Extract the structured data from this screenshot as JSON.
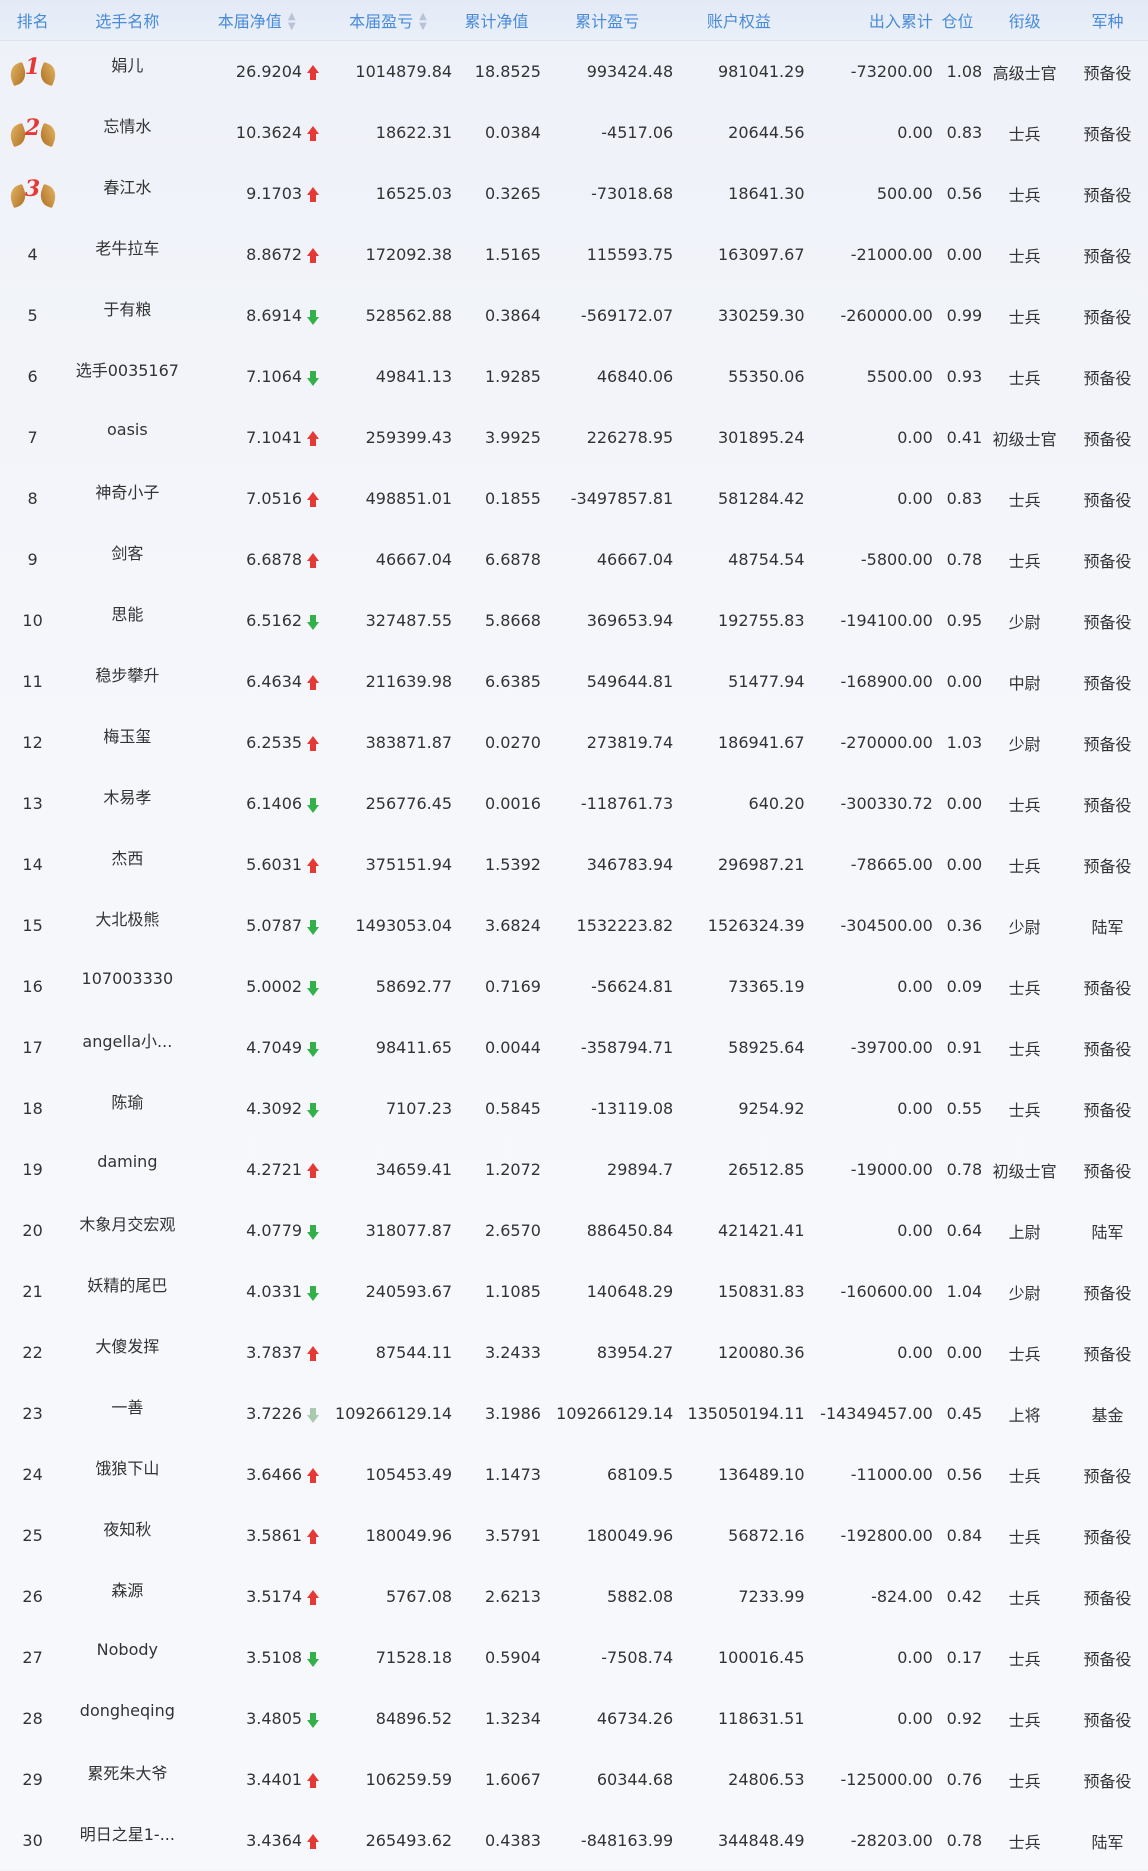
{
  "colors": {
    "header_text": "#4a8bd8",
    "up_arrow": "#e53935",
    "down_arrow": "#34b04a",
    "medal_number": "#e53935"
  },
  "headers": {
    "rank": "排名",
    "name": "选手名称",
    "current_nav": "本届净值",
    "current_pnl": "本届盈亏",
    "total_nav": "累计净值",
    "total_pnl": "累计盈亏",
    "equity": "账户权益",
    "flow": "出入累计",
    "position": "仓位",
    "level": "衔级",
    "arm": "军种"
  },
  "rows": [
    {
      "rank": "1",
      "medal": true,
      "name": "娟儿",
      "current_nav": "26.9204",
      "trend": "up",
      "current_pnl": "1014879.84",
      "total_nav": "18.8525",
      "total_pnl": "993424.48",
      "equity": "981041.29",
      "flow": "-73200.00",
      "position": "1.08",
      "level": "高级士官",
      "arm": "预备役"
    },
    {
      "rank": "2",
      "medal": true,
      "name": "忘情水",
      "current_nav": "10.3624",
      "trend": "up",
      "current_pnl": "18622.31",
      "total_nav": "0.0384",
      "total_pnl": "-4517.06",
      "equity": "20644.56",
      "flow": "0.00",
      "position": "0.83",
      "level": "士兵",
      "arm": "预备役"
    },
    {
      "rank": "3",
      "medal": true,
      "name": "春江水",
      "current_nav": "9.1703",
      "trend": "up",
      "current_pnl": "16525.03",
      "total_nav": "0.3265",
      "total_pnl": "-73018.68",
      "equity": "18641.30",
      "flow": "500.00",
      "position": "0.56",
      "level": "士兵",
      "arm": "预备役"
    },
    {
      "rank": "4",
      "medal": false,
      "name": "老牛拉车",
      "current_nav": "8.8672",
      "trend": "up",
      "current_pnl": "172092.38",
      "total_nav": "1.5165",
      "total_pnl": "115593.75",
      "equity": "163097.67",
      "flow": "-21000.00",
      "position": "0.00",
      "level": "士兵",
      "arm": "预备役"
    },
    {
      "rank": "5",
      "medal": false,
      "name": "于有粮",
      "current_nav": "8.6914",
      "trend": "down",
      "current_pnl": "528562.88",
      "total_nav": "0.3864",
      "total_pnl": "-569172.07",
      "equity": "330259.30",
      "flow": "-260000.00",
      "position": "0.99",
      "level": "士兵",
      "arm": "预备役"
    },
    {
      "rank": "6",
      "medal": false,
      "name": "选手0035167",
      "current_nav": "7.1064",
      "trend": "down",
      "current_pnl": "49841.13",
      "total_nav": "1.9285",
      "total_pnl": "46840.06",
      "equity": "55350.06",
      "flow": "5500.00",
      "position": "0.93",
      "level": "士兵",
      "arm": "预备役"
    },
    {
      "rank": "7",
      "medal": false,
      "name": "oasis",
      "current_nav": "7.1041",
      "trend": "up",
      "current_pnl": "259399.43",
      "total_nav": "3.9925",
      "total_pnl": "226278.95",
      "equity": "301895.24",
      "flow": "0.00",
      "position": "0.41",
      "level": "初级士官",
      "arm": "预备役"
    },
    {
      "rank": "8",
      "medal": false,
      "name": "神奇小子",
      "current_nav": "7.0516",
      "trend": "up",
      "current_pnl": "498851.01",
      "total_nav": "0.1855",
      "total_pnl": "-3497857.81",
      "equity": "581284.42",
      "flow": "0.00",
      "position": "0.83",
      "level": "士兵",
      "arm": "预备役"
    },
    {
      "rank": "9",
      "medal": false,
      "name": "剑客",
      "current_nav": "6.6878",
      "trend": "up",
      "current_pnl": "46667.04",
      "total_nav": "6.6878",
      "total_pnl": "46667.04",
      "equity": "48754.54",
      "flow": "-5800.00",
      "position": "0.78",
      "level": "士兵",
      "arm": "预备役"
    },
    {
      "rank": "10",
      "medal": false,
      "name": "思能",
      "current_nav": "6.5162",
      "trend": "down",
      "current_pnl": "327487.55",
      "total_nav": "5.8668",
      "total_pnl": "369653.94",
      "equity": "192755.83",
      "flow": "-194100.00",
      "position": "0.95",
      "level": "少尉",
      "arm": "预备役"
    },
    {
      "rank": "11",
      "medal": false,
      "name": "稳步攀升",
      "current_nav": "6.4634",
      "trend": "up",
      "current_pnl": "211639.98",
      "total_nav": "6.6385",
      "total_pnl": "549644.81",
      "equity": "51477.94",
      "flow": "-168900.00",
      "position": "0.00",
      "level": "中尉",
      "arm": "预备役"
    },
    {
      "rank": "12",
      "medal": false,
      "name": "梅玉玺",
      "current_nav": "6.2535",
      "trend": "up",
      "current_pnl": "383871.87",
      "total_nav": "0.0270",
      "total_pnl": "273819.74",
      "equity": "186941.67",
      "flow": "-270000.00",
      "position": "1.03",
      "level": "少尉",
      "arm": "预备役"
    },
    {
      "rank": "13",
      "medal": false,
      "name": "木易孝",
      "current_nav": "6.1406",
      "trend": "down",
      "current_pnl": "256776.45",
      "total_nav": "0.0016",
      "total_pnl": "-118761.73",
      "equity": "640.20",
      "flow": "-300330.72",
      "position": "0.00",
      "level": "士兵",
      "arm": "预备役"
    },
    {
      "rank": "14",
      "medal": false,
      "name": "杰西",
      "current_nav": "5.6031",
      "trend": "up",
      "current_pnl": "375151.94",
      "total_nav": "1.5392",
      "total_pnl": "346783.94",
      "equity": "296987.21",
      "flow": "-78665.00",
      "position": "0.00",
      "level": "士兵",
      "arm": "预备役"
    },
    {
      "rank": "15",
      "medal": false,
      "name": "大北极熊",
      "current_nav": "5.0787",
      "trend": "down",
      "current_pnl": "1493053.04",
      "total_nav": "3.6824",
      "total_pnl": "1532223.82",
      "equity": "1526324.39",
      "flow": "-304500.00",
      "position": "0.36",
      "level": "少尉",
      "arm": "陆军"
    },
    {
      "rank": "16",
      "medal": false,
      "name": "107003330",
      "current_nav": "5.0002",
      "trend": "down",
      "current_pnl": "58692.77",
      "total_nav": "0.7169",
      "total_pnl": "-56624.81",
      "equity": "73365.19",
      "flow": "0.00",
      "position": "0.09",
      "level": "士兵",
      "arm": "预备役"
    },
    {
      "rank": "17",
      "medal": false,
      "name": "angella小...",
      "current_nav": "4.7049",
      "trend": "down",
      "current_pnl": "98411.65",
      "total_nav": "0.0044",
      "total_pnl": "-358794.71",
      "equity": "58925.64",
      "flow": "-39700.00",
      "position": "0.91",
      "level": "士兵",
      "arm": "预备役"
    },
    {
      "rank": "18",
      "medal": false,
      "name": "陈瑜",
      "current_nav": "4.3092",
      "trend": "down",
      "current_pnl": "7107.23",
      "total_nav": "0.5845",
      "total_pnl": "-13119.08",
      "equity": "9254.92",
      "flow": "0.00",
      "position": "0.55",
      "level": "士兵",
      "arm": "预备役"
    },
    {
      "rank": "19",
      "medal": false,
      "name": "daming",
      "current_nav": "4.2721",
      "trend": "up",
      "current_pnl": "34659.41",
      "total_nav": "1.2072",
      "total_pnl": "29894.7",
      "equity": "26512.85",
      "flow": "-19000.00",
      "position": "0.78",
      "level": "初级士官",
      "arm": "预备役"
    },
    {
      "rank": "20",
      "medal": false,
      "name": "木象月交宏观",
      "current_nav": "4.0779",
      "trend": "down",
      "current_pnl": "318077.87",
      "total_nav": "2.6570",
      "total_pnl": "886450.84",
      "equity": "421421.41",
      "flow": "0.00",
      "position": "0.64",
      "level": "上尉",
      "arm": "陆军"
    },
    {
      "rank": "21",
      "medal": false,
      "name": "妖精的尾巴",
      "current_nav": "4.0331",
      "trend": "down",
      "current_pnl": "240593.67",
      "total_nav": "1.1085",
      "total_pnl": "140648.29",
      "equity": "150831.83",
      "flow": "-160600.00",
      "position": "1.04",
      "level": "少尉",
      "arm": "预备役"
    },
    {
      "rank": "22",
      "medal": false,
      "name": "大傻发挥",
      "current_nav": "3.7837",
      "trend": "up",
      "current_pnl": "87544.11",
      "total_nav": "3.2433",
      "total_pnl": "83954.27",
      "equity": "120080.36",
      "flow": "0.00",
      "position": "0.00",
      "level": "士兵",
      "arm": "预备役"
    },
    {
      "rank": "23",
      "medal": false,
      "name": "一善",
      "current_nav": "3.7226",
      "trend": "down-faded",
      "current_pnl": "109266129.14",
      "total_nav": "3.1986",
      "total_pnl": "109266129.14",
      "equity": "135050194.11",
      "flow": "-14349457.00",
      "position": "0.45",
      "level": "上将",
      "arm": "基金"
    },
    {
      "rank": "24",
      "medal": false,
      "name": "饿狼下山",
      "current_nav": "3.6466",
      "trend": "up",
      "current_pnl": "105453.49",
      "total_nav": "1.1473",
      "total_pnl": "68109.5",
      "equity": "136489.10",
      "flow": "-11000.00",
      "position": "0.56",
      "level": "士兵",
      "arm": "预备役"
    },
    {
      "rank": "25",
      "medal": false,
      "name": "夜知秋",
      "current_nav": "3.5861",
      "trend": "up",
      "current_pnl": "180049.96",
      "total_nav": "3.5791",
      "total_pnl": "180049.96",
      "equity": "56872.16",
      "flow": "-192800.00",
      "position": "0.84",
      "level": "士兵",
      "arm": "预备役"
    },
    {
      "rank": "26",
      "medal": false,
      "name": "森源",
      "current_nav": "3.5174",
      "trend": "up",
      "current_pnl": "5767.08",
      "total_nav": "2.6213",
      "total_pnl": "5882.08",
      "equity": "7233.99",
      "flow": "-824.00",
      "position": "0.42",
      "level": "士兵",
      "arm": "预备役"
    },
    {
      "rank": "27",
      "medal": false,
      "name": "Nobody",
      "current_nav": "3.5108",
      "trend": "down",
      "current_pnl": "71528.18",
      "total_nav": "0.5904",
      "total_pnl": "-7508.74",
      "equity": "100016.45",
      "flow": "0.00",
      "position": "0.17",
      "level": "士兵",
      "arm": "预备役"
    },
    {
      "rank": "28",
      "medal": false,
      "name": "dongheqing",
      "current_nav": "3.4805",
      "trend": "down",
      "current_pnl": "84896.52",
      "total_nav": "1.3234",
      "total_pnl": "46734.26",
      "equity": "118631.51",
      "flow": "0.00",
      "position": "0.92",
      "level": "士兵",
      "arm": "预备役"
    },
    {
      "rank": "29",
      "medal": false,
      "name": "累死朱大爷",
      "current_nav": "3.4401",
      "trend": "up",
      "current_pnl": "106259.59",
      "total_nav": "1.6067",
      "total_pnl": "60344.68",
      "equity": "24806.53",
      "flow": "-125000.00",
      "position": "0.76",
      "level": "士兵",
      "arm": "预备役"
    },
    {
      "rank": "30",
      "medal": false,
      "name": "明日之星1-...",
      "current_nav": "3.4364",
      "trend": "up",
      "current_pnl": "265493.62",
      "total_nav": "0.4383",
      "total_pnl": "-848163.99",
      "equity": "344848.49",
      "flow": "-28203.00",
      "position": "0.78",
      "level": "士兵",
      "arm": "陆军"
    }
  ]
}
